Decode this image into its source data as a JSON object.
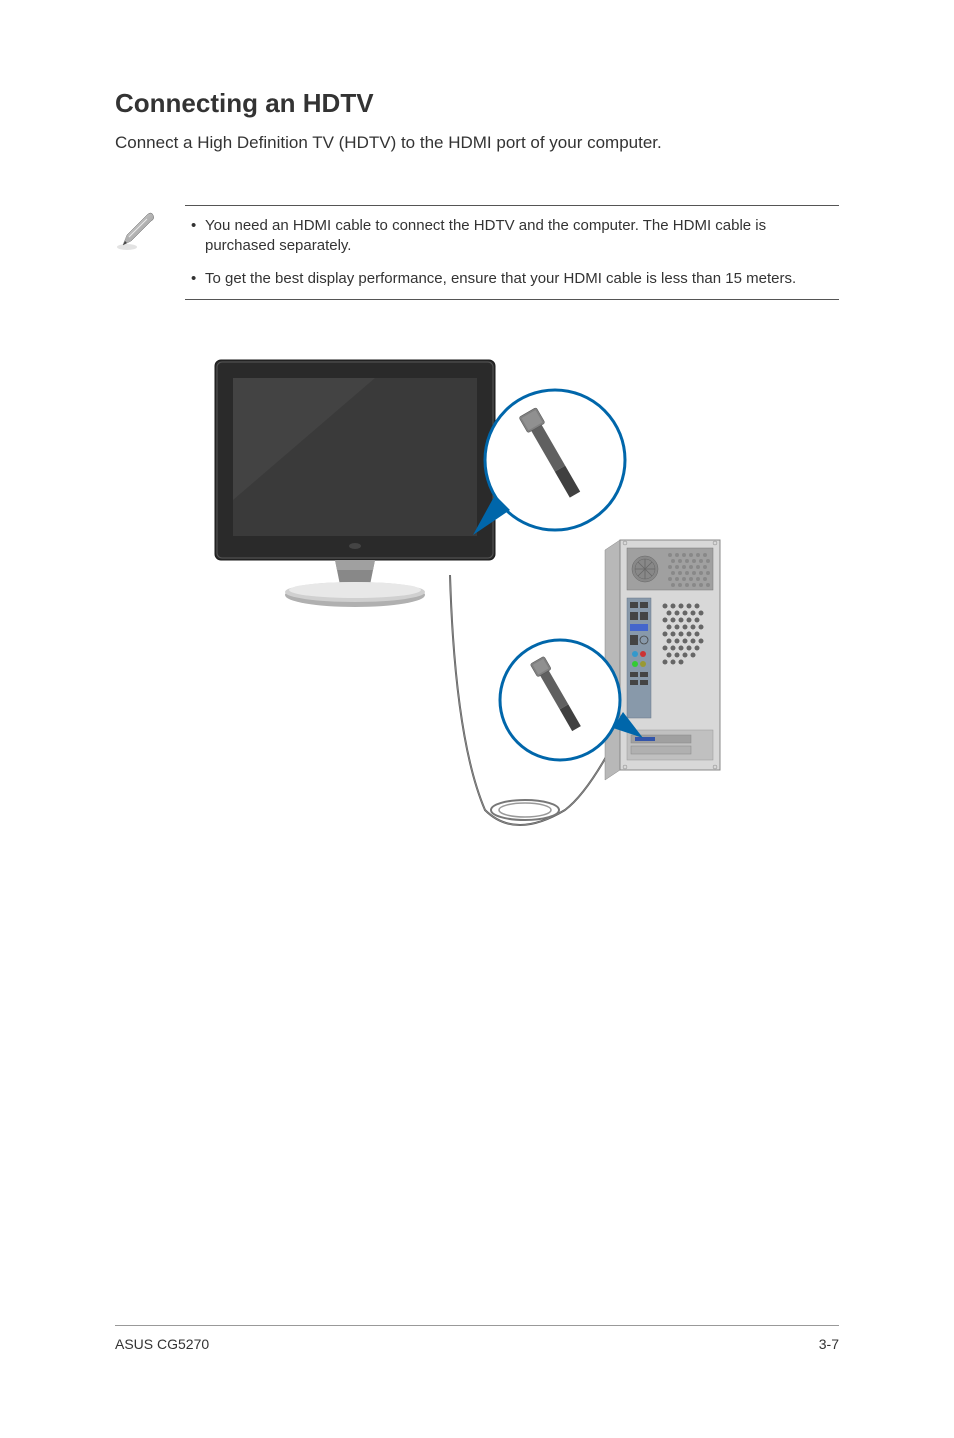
{
  "heading": "Connecting an HDTV",
  "intro": "Connect a High Definition TV (HDTV) to the HDMI port of your computer.",
  "notes": [
    "You need an HDMI cable to connect the HDTV and the computer. The HDMI cable is purchased separately.",
    "To get the best display performance, ensure that your HDMI cable is less than 15 meters."
  ],
  "footer": {
    "left": "ASUS CG5270",
    "right": "3-7"
  }
}
